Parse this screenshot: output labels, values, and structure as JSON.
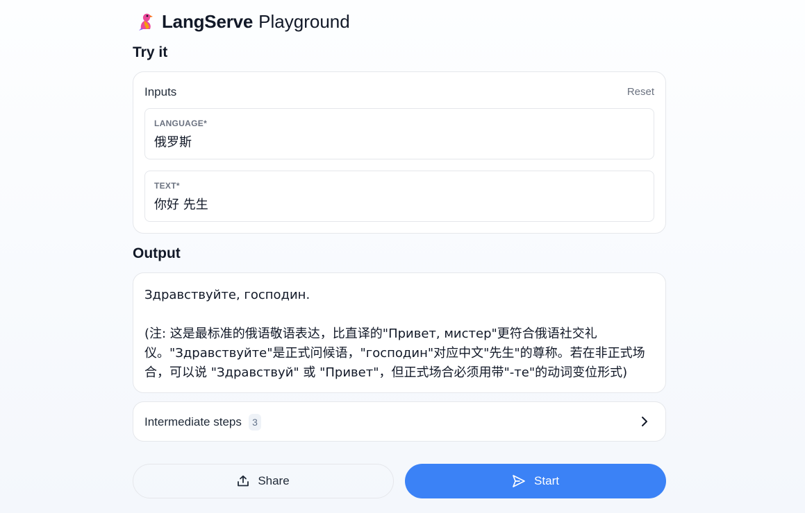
{
  "header": {
    "brand_name": "LangServe",
    "brand_sub": "Playground",
    "logo_icon": "parrot-icon"
  },
  "sections": {
    "try_it": "Try it",
    "output": "Output"
  },
  "inputs": {
    "title": "Inputs",
    "reset_label": "Reset",
    "fields": [
      {
        "label": "LANGUAGE*",
        "value": "俄罗斯"
      },
      {
        "label": "TEXT*",
        "value": "你好 先生"
      }
    ]
  },
  "output": {
    "text": "Здравствуйте, господин.\n\n(注: 这是最标准的俄语敬语表达，比直译的\"Привет, мистер\"更符合俄语社交礼\n仪。\"Здравствуйте\"是正式问候语，\"господин\"对应中文\"先生\"的尊称。若在非正式场\n合，可以说 \"Здравствуй\" 或 \"Привет\"，但正式场合必须用带\"-те\"的动词变位形式)"
  },
  "steps": {
    "label": "Intermediate steps",
    "count": "3"
  },
  "buttons": {
    "share": "Share",
    "start": "Start"
  },
  "colors": {
    "accent": "#3b82f6",
    "border": "#e5e7eb",
    "muted": "#6b7280"
  }
}
